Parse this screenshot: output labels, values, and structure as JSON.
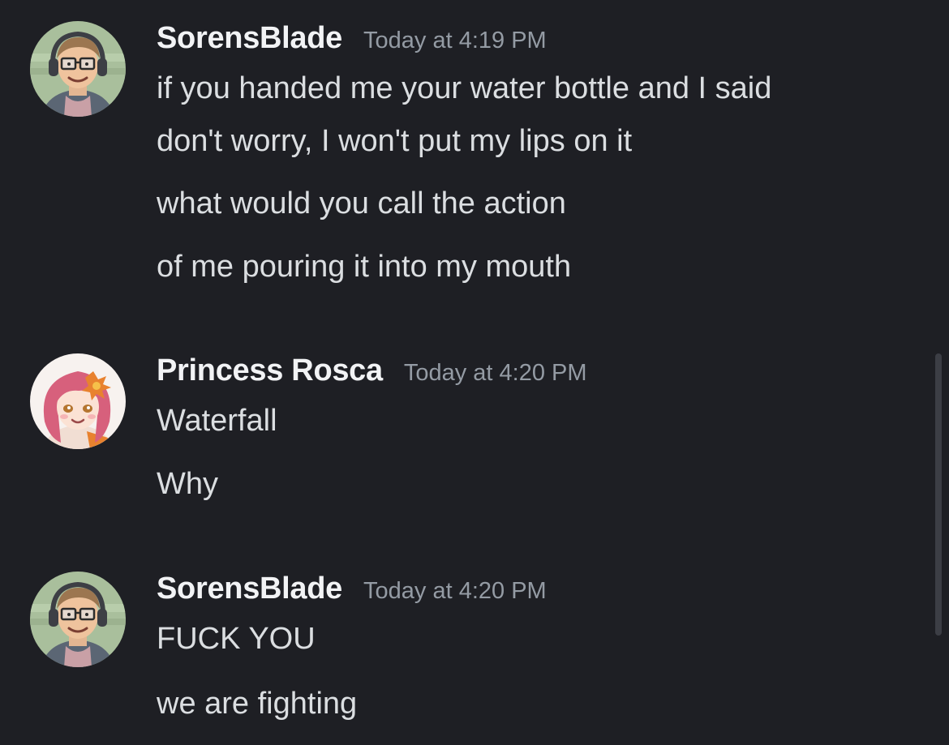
{
  "messages": [
    {
      "username": "SorensBlade",
      "timestamp": "Today at 4:19 PM",
      "lines": [
        "if you handed me your water bottle and I said",
        "don't worry, I won't put my lips on it",
        "what would you call the action",
        "of me pouring it into my mouth"
      ]
    },
    {
      "username": "Princess Rosca",
      "timestamp": "Today at 4:20 PM",
      "lines": [
        "Waterfall",
        "Why"
      ]
    },
    {
      "username": "SorensBlade",
      "timestamp": "Today at 4:20 PM",
      "lines": [
        "FUCK YOU",
        "we are fighting"
      ]
    }
  ],
  "avatars": {
    "sorensblade": "avatar-glasses-headphones",
    "princess_rosca": "avatar-pink-hair-girl"
  },
  "colors": {
    "background": "#1e1f24",
    "username": "#f2f3f5",
    "timestamp": "#949ba4",
    "message_text": "#dbdee1"
  }
}
